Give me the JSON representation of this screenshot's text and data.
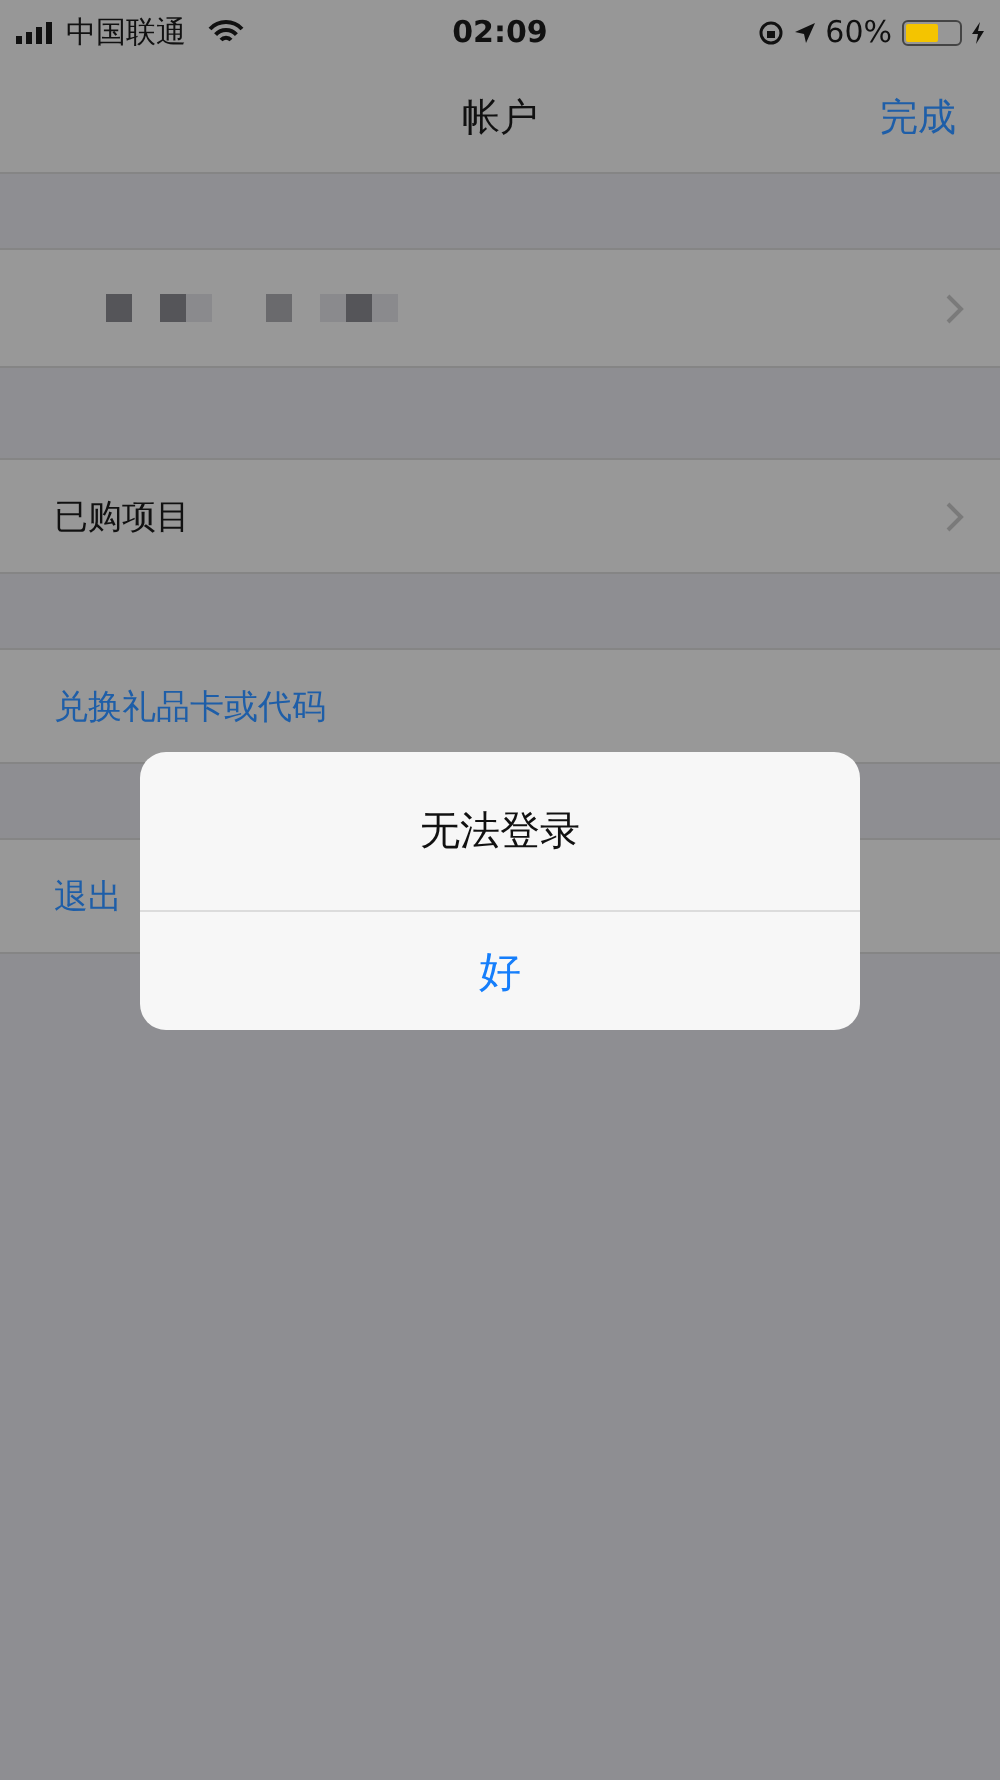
{
  "status_bar": {
    "carrier": "中国联通",
    "time": "02:09",
    "battery_text": "60%"
  },
  "nav_bar": {
    "title": "帐户",
    "done": "完成"
  },
  "rows": [
    {
      "kind": "account"
    },
    {
      "kind": "link",
      "label": "已购项目"
    },
    {
      "kind": "action",
      "label": "兑换礼品卡或代码"
    },
    {
      "kind": "action",
      "label": "退出"
    }
  ],
  "alert": {
    "title": "无法登录",
    "button": "好"
  }
}
